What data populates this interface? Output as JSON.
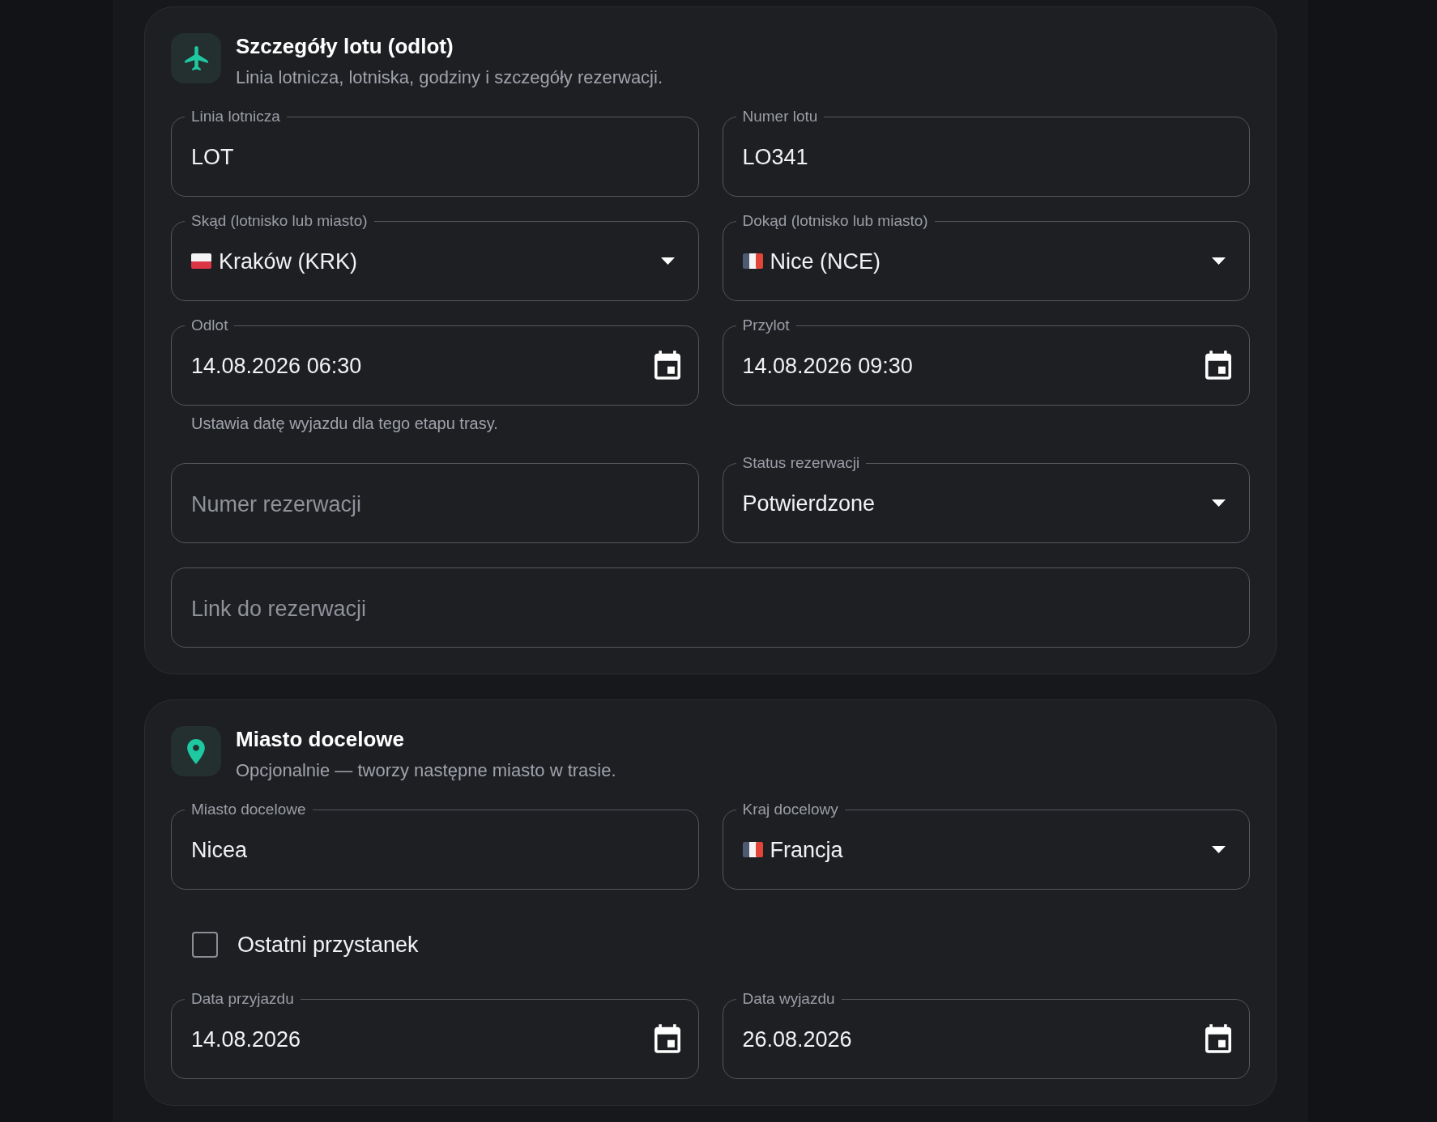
{
  "sections": [
    {
      "kind": "flight",
      "title": "Szczegóły lotu (odlot)",
      "subtitle": "Linia lotnicza, lotniska, godziny i szczegóły rezerwacji.",
      "rows": [
        {
          "kind": "fields",
          "fields": [
            {
              "kind": "text",
              "label": "Linia lotnicza",
              "value": "LOT"
            },
            {
              "kind": "text",
              "label": "Numer lotu",
              "value": "LO341"
            }
          ]
        },
        {
          "kind": "fields",
          "fields": [
            {
              "kind": "select",
              "label": "Skąd (lotnisko lub miasto)",
              "flag": {
                "kind": "poland"
              },
              "value": "Kraków (KRK)"
            },
            {
              "kind": "select",
              "label": "Dokąd (lotnisko lub miasto)",
              "flag": {
                "kind": "france"
              },
              "value": "Nice (NCE)"
            }
          ]
        },
        {
          "kind": "fields",
          "fields": [
            {
              "kind": "date",
              "label": "Odlot",
              "value": "14.08.2026 06:30",
              "helper": "Ustawia datę wyjazdu dla tego etapu trasy."
            },
            {
              "kind": "date",
              "label": "Przylot",
              "value": "14.08.2026 09:30"
            }
          ]
        },
        {
          "kind": "fields",
          "fields": [
            {
              "kind": "text",
              "placeholder": "Numer rezerwacji"
            },
            {
              "kind": "select",
              "label": "Status rezerwacji",
              "value": "Potwierdzone"
            }
          ]
        },
        {
          "kind": "fields",
          "fields": [
            {
              "kind": "text",
              "placeholder": "Link do rezerwacji"
            }
          ]
        }
      ]
    },
    {
      "kind": "destination",
      "title": "Miasto docelowe",
      "subtitle": "Opcjonalnie — tworzy następne miasto w trasie.",
      "rows": [
        {
          "kind": "fields",
          "fields": [
            {
              "kind": "text",
              "label": "Miasto docelowe",
              "value": "Nicea"
            },
            {
              "kind": "select",
              "label": "Kraj docelowy",
              "flag": {
                "kind": "france"
              },
              "value": "Francja"
            }
          ]
        },
        {
          "kind": "checkbox",
          "label": "Ostatni przystanek",
          "checked": false
        },
        {
          "kind": "fields",
          "fields": [
            {
              "kind": "date",
              "label": "Data przyjazdu",
              "value": "14.08.2026"
            },
            {
              "kind": "date",
              "label": "Data wyjazdu",
              "value": "26.08.2026"
            }
          ]
        }
      ]
    }
  ]
}
